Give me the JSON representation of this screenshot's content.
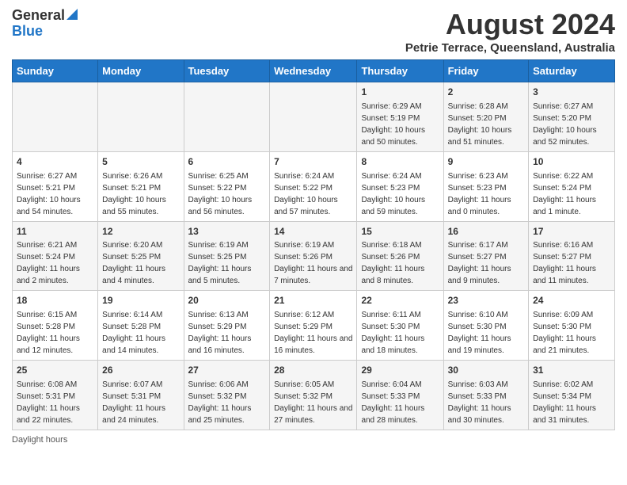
{
  "logo": {
    "general": "General",
    "blue": "Blue"
  },
  "title": "August 2024",
  "subtitle": "Petrie Terrace, Queensland, Australia",
  "days_of_week": [
    "Sunday",
    "Monday",
    "Tuesday",
    "Wednesday",
    "Thursday",
    "Friday",
    "Saturday"
  ],
  "weeks": [
    [
      {
        "day": "",
        "sunrise": "",
        "sunset": "",
        "daylight": ""
      },
      {
        "day": "",
        "sunrise": "",
        "sunset": "",
        "daylight": ""
      },
      {
        "day": "",
        "sunrise": "",
        "sunset": "",
        "daylight": ""
      },
      {
        "day": "",
        "sunrise": "",
        "sunset": "",
        "daylight": ""
      },
      {
        "day": "1",
        "sunrise": "Sunrise: 6:29 AM",
        "sunset": "Sunset: 5:19 PM",
        "daylight": "Daylight: 10 hours and 50 minutes."
      },
      {
        "day": "2",
        "sunrise": "Sunrise: 6:28 AM",
        "sunset": "Sunset: 5:20 PM",
        "daylight": "Daylight: 10 hours and 51 minutes."
      },
      {
        "day": "3",
        "sunrise": "Sunrise: 6:27 AM",
        "sunset": "Sunset: 5:20 PM",
        "daylight": "Daylight: 10 hours and 52 minutes."
      }
    ],
    [
      {
        "day": "4",
        "sunrise": "Sunrise: 6:27 AM",
        "sunset": "Sunset: 5:21 PM",
        "daylight": "Daylight: 10 hours and 54 minutes."
      },
      {
        "day": "5",
        "sunrise": "Sunrise: 6:26 AM",
        "sunset": "Sunset: 5:21 PM",
        "daylight": "Daylight: 10 hours and 55 minutes."
      },
      {
        "day": "6",
        "sunrise": "Sunrise: 6:25 AM",
        "sunset": "Sunset: 5:22 PM",
        "daylight": "Daylight: 10 hours and 56 minutes."
      },
      {
        "day": "7",
        "sunrise": "Sunrise: 6:24 AM",
        "sunset": "Sunset: 5:22 PM",
        "daylight": "Daylight: 10 hours and 57 minutes."
      },
      {
        "day": "8",
        "sunrise": "Sunrise: 6:24 AM",
        "sunset": "Sunset: 5:23 PM",
        "daylight": "Daylight: 10 hours and 59 minutes."
      },
      {
        "day": "9",
        "sunrise": "Sunrise: 6:23 AM",
        "sunset": "Sunset: 5:23 PM",
        "daylight": "Daylight: 11 hours and 0 minutes."
      },
      {
        "day": "10",
        "sunrise": "Sunrise: 6:22 AM",
        "sunset": "Sunset: 5:24 PM",
        "daylight": "Daylight: 11 hours and 1 minute."
      }
    ],
    [
      {
        "day": "11",
        "sunrise": "Sunrise: 6:21 AM",
        "sunset": "Sunset: 5:24 PM",
        "daylight": "Daylight: 11 hours and 2 minutes."
      },
      {
        "day": "12",
        "sunrise": "Sunrise: 6:20 AM",
        "sunset": "Sunset: 5:25 PM",
        "daylight": "Daylight: 11 hours and 4 minutes."
      },
      {
        "day": "13",
        "sunrise": "Sunrise: 6:19 AM",
        "sunset": "Sunset: 5:25 PM",
        "daylight": "Daylight: 11 hours and 5 minutes."
      },
      {
        "day": "14",
        "sunrise": "Sunrise: 6:19 AM",
        "sunset": "Sunset: 5:26 PM",
        "daylight": "Daylight: 11 hours and 7 minutes."
      },
      {
        "day": "15",
        "sunrise": "Sunrise: 6:18 AM",
        "sunset": "Sunset: 5:26 PM",
        "daylight": "Daylight: 11 hours and 8 minutes."
      },
      {
        "day": "16",
        "sunrise": "Sunrise: 6:17 AM",
        "sunset": "Sunset: 5:27 PM",
        "daylight": "Daylight: 11 hours and 9 minutes."
      },
      {
        "day": "17",
        "sunrise": "Sunrise: 6:16 AM",
        "sunset": "Sunset: 5:27 PM",
        "daylight": "Daylight: 11 hours and 11 minutes."
      }
    ],
    [
      {
        "day": "18",
        "sunrise": "Sunrise: 6:15 AM",
        "sunset": "Sunset: 5:28 PM",
        "daylight": "Daylight: 11 hours and 12 minutes."
      },
      {
        "day": "19",
        "sunrise": "Sunrise: 6:14 AM",
        "sunset": "Sunset: 5:28 PM",
        "daylight": "Daylight: 11 hours and 14 minutes."
      },
      {
        "day": "20",
        "sunrise": "Sunrise: 6:13 AM",
        "sunset": "Sunset: 5:29 PM",
        "daylight": "Daylight: 11 hours and 16 minutes."
      },
      {
        "day": "21",
        "sunrise": "Sunrise: 6:12 AM",
        "sunset": "Sunset: 5:29 PM",
        "daylight": "Daylight: 11 hours and 16 minutes."
      },
      {
        "day": "22",
        "sunrise": "Sunrise: 6:11 AM",
        "sunset": "Sunset: 5:30 PM",
        "daylight": "Daylight: 11 hours and 18 minutes."
      },
      {
        "day": "23",
        "sunrise": "Sunrise: 6:10 AM",
        "sunset": "Sunset: 5:30 PM",
        "daylight": "Daylight: 11 hours and 19 minutes."
      },
      {
        "day": "24",
        "sunrise": "Sunrise: 6:09 AM",
        "sunset": "Sunset: 5:30 PM",
        "daylight": "Daylight: 11 hours and 21 minutes."
      }
    ],
    [
      {
        "day": "25",
        "sunrise": "Sunrise: 6:08 AM",
        "sunset": "Sunset: 5:31 PM",
        "daylight": "Daylight: 11 hours and 22 minutes."
      },
      {
        "day": "26",
        "sunrise": "Sunrise: 6:07 AM",
        "sunset": "Sunset: 5:31 PM",
        "daylight": "Daylight: 11 hours and 24 minutes."
      },
      {
        "day": "27",
        "sunrise": "Sunrise: 6:06 AM",
        "sunset": "Sunset: 5:32 PM",
        "daylight": "Daylight: 11 hours and 25 minutes."
      },
      {
        "day": "28",
        "sunrise": "Sunrise: 6:05 AM",
        "sunset": "Sunset: 5:32 PM",
        "daylight": "Daylight: 11 hours and 27 minutes."
      },
      {
        "day": "29",
        "sunrise": "Sunrise: 6:04 AM",
        "sunset": "Sunset: 5:33 PM",
        "daylight": "Daylight: 11 hours and 28 minutes."
      },
      {
        "day": "30",
        "sunrise": "Sunrise: 6:03 AM",
        "sunset": "Sunset: 5:33 PM",
        "daylight": "Daylight: 11 hours and 30 minutes."
      },
      {
        "day": "31",
        "sunrise": "Sunrise: 6:02 AM",
        "sunset": "Sunset: 5:34 PM",
        "daylight": "Daylight: 11 hours and 31 minutes."
      }
    ]
  ],
  "footer": {
    "daylight_label": "Daylight hours"
  }
}
